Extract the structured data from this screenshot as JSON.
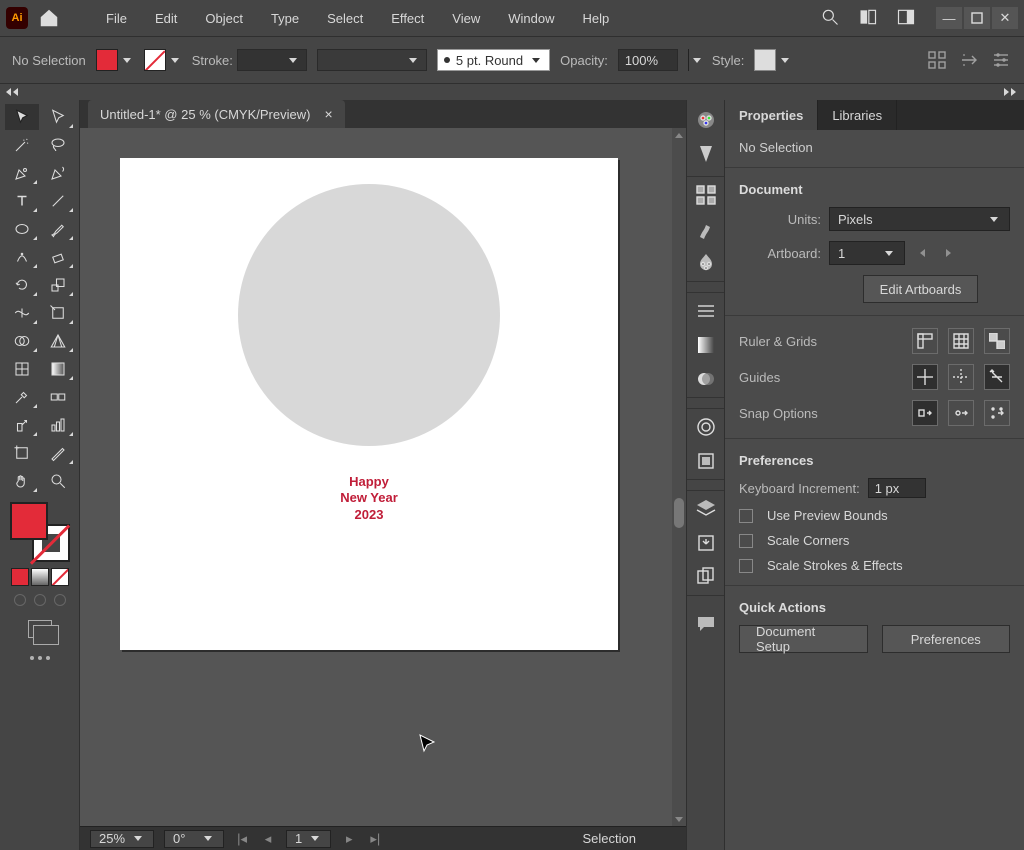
{
  "menubar": {
    "logo": "Ai",
    "items": [
      "File",
      "Edit",
      "Object",
      "Type",
      "Select",
      "Effect",
      "View",
      "Window",
      "Help"
    ]
  },
  "controlbar": {
    "selection_label": "No Selection",
    "stroke_label": "Stroke:",
    "stroke_profile": "5 pt. Round",
    "opacity_label": "Opacity:",
    "opacity_value": "100%",
    "style_label": "Style:"
  },
  "document": {
    "tab_title": "Untitled-1* @ 25 % (CMYK/Preview)",
    "artwork": {
      "text_line1": "Happy",
      "text_line2": "New Year",
      "text_line3": "2023"
    }
  },
  "statusbar": {
    "zoom": "25%",
    "rotation": "0°",
    "artboard": "1",
    "mode": "Selection"
  },
  "panel": {
    "tabs": {
      "properties": "Properties",
      "libraries": "Libraries"
    },
    "no_selection": "No Selection",
    "document_section": "Document",
    "units_label": "Units:",
    "units_value": "Pixels",
    "artboard_label": "Artboard:",
    "artboard_value": "1",
    "edit_artboards": "Edit Artboards",
    "ruler_grids": "Ruler & Grids",
    "guides": "Guides",
    "snap_options": "Snap Options",
    "preferences_section": "Preferences",
    "kbd_inc_label": "Keyboard Increment:",
    "kbd_inc_value": "1 px",
    "use_preview_bounds": "Use Preview Bounds",
    "scale_corners": "Scale Corners",
    "scale_strokes": "Scale Strokes & Effects",
    "quick_actions": "Quick Actions",
    "doc_setup": "Document Setup",
    "prefs_btn": "Preferences"
  }
}
